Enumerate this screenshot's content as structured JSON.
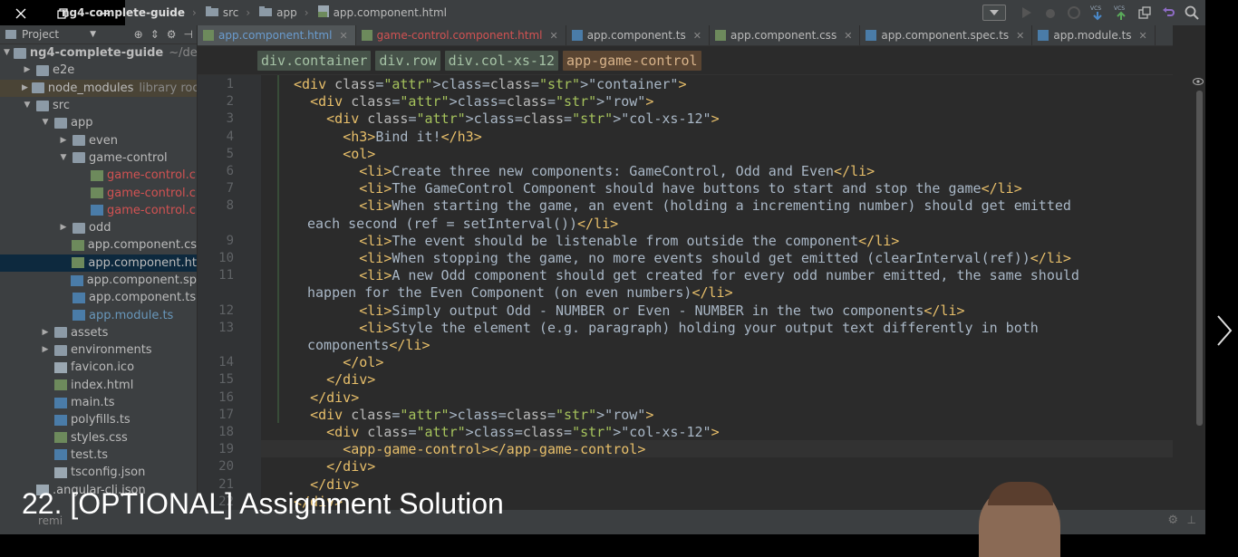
{
  "topbar": {
    "crumbs": [
      "ng4-complete-guide",
      "src",
      "app",
      "app.component.html"
    ]
  },
  "sidebar": {
    "header": "Project",
    "items": [
      {
        "label": "ng4-complete-guide",
        "extra": "~/dev"
      },
      {
        "label": "e2e"
      },
      {
        "label": "node_modules",
        "extra": "library roo"
      },
      {
        "label": "src"
      },
      {
        "label": "app"
      },
      {
        "label": "even"
      },
      {
        "label": "game-control"
      },
      {
        "label": "game-control.c"
      },
      {
        "label": "game-control.c"
      },
      {
        "label": "game-control.c"
      },
      {
        "label": "odd"
      },
      {
        "label": "app.component.cs"
      },
      {
        "label": "app.component.ht"
      },
      {
        "label": "app.component.sp"
      },
      {
        "label": "app.component.ts"
      },
      {
        "label": "app.module.ts"
      },
      {
        "label": "assets"
      },
      {
        "label": "environments"
      },
      {
        "label": "favicon.ico"
      },
      {
        "label": "index.html"
      },
      {
        "label": "main.ts"
      },
      {
        "label": "polyfills.ts"
      },
      {
        "label": "styles.css"
      },
      {
        "label": "test.ts"
      },
      {
        "label": "tsconfig.json"
      },
      {
        "label": ".angular-cli.json"
      }
    ]
  },
  "tabs": [
    {
      "label": "app.component.html",
      "active": true
    },
    {
      "label": "game-control.component.html"
    },
    {
      "label": "app.component.ts"
    },
    {
      "label": "app.component.css"
    },
    {
      "label": "app.component.spec.ts"
    },
    {
      "label": "app.module.ts"
    }
  ],
  "pathbar": [
    "div.container",
    "div.row",
    "div.col-xs-12",
    "app-game-control"
  ],
  "editor": {
    "line_numbers": [
      "1",
      "2",
      "3",
      "4",
      "5",
      "6",
      "7",
      "8",
      "9",
      "10",
      "11",
      "12",
      "13",
      "14",
      "15",
      "16",
      "17",
      "18",
      "19",
      "20",
      "21",
      "22"
    ],
    "lines": [
      "<div class=\"container\">",
      "  <div class=\"row\">",
      "    <div class=\"col-xs-12\">",
      "      <h3>Bind it!</h3>",
      "      <ol>",
      "        <li>Create three new components: GameControl, Odd and Even</li>",
      "        <li>The GameControl Component should have buttons to start and stop the game</li>",
      "        <li>When starting the game, an event (holding a incrementing number) should get emitted",
      "each second (ref = setInterval())</li>",
      "        <li>The event should be listenable from outside the component</li>",
      "        <li>When stopping the game, no more events should get emitted (clearInterval(ref))</li>",
      "        <li>A new Odd component should get created for every odd number emitted, the same should",
      "happen for the Even Component (on even numbers)</li>",
      "        <li>Simply output Odd - NUMBER or Even - NUMBER in the two components</li>",
      "        <li>Style the element (e.g. paragraph) holding your output text differently in both",
      "components</li>",
      "      </ol>",
      "    </div>",
      "  </div>",
      "  <div class=\"row\">",
      "    <div class=\"col-xs-12\">",
      "      <app-game-control></app-game-control>",
      "    </div>",
      "  </div>",
      "</div>"
    ]
  },
  "caption": "22. [OPTIONAL] Assignment Solution",
  "bottom_hint": "remi"
}
